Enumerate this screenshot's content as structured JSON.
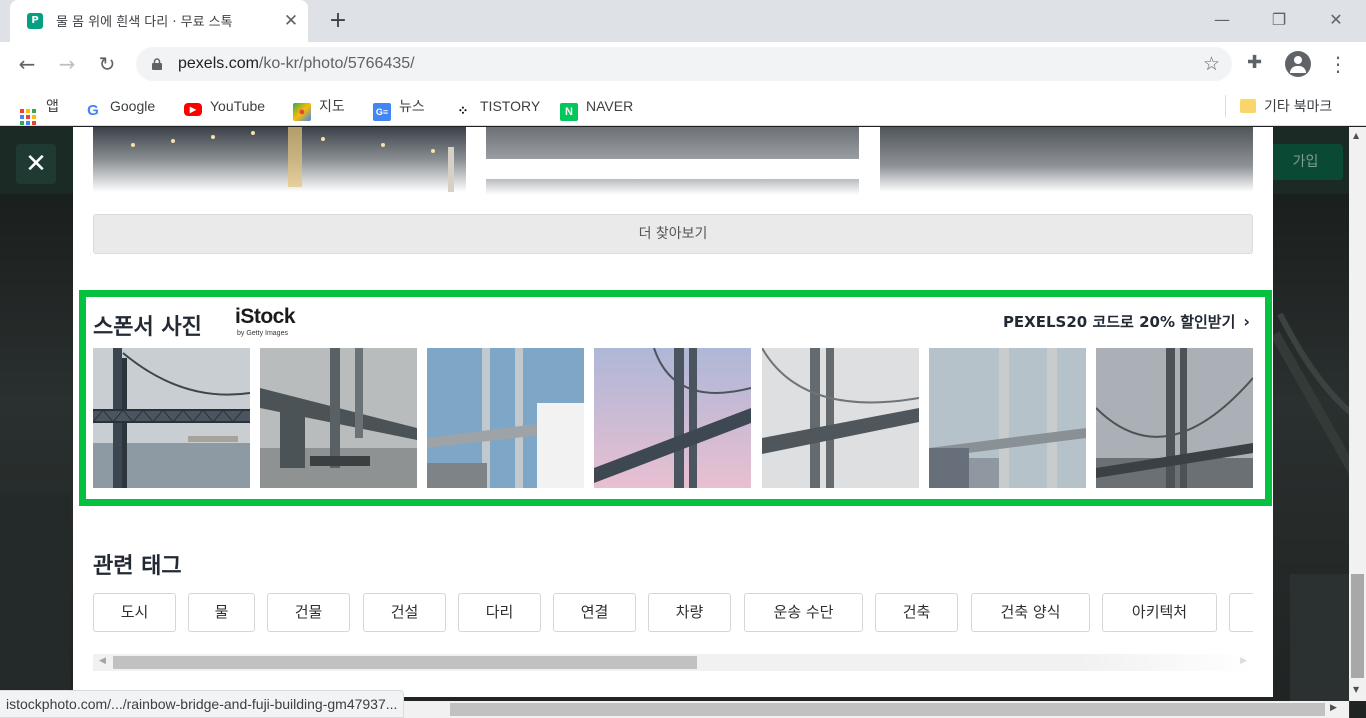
{
  "browser": {
    "tab_title": "물 몸 위에 흰색 다리 · 무료 스톡",
    "tab_favicon": "P",
    "url_host": "pexels.com",
    "url_path": "/ko-kr/photo/5766435/",
    "bookmarks": [
      {
        "label": "앱",
        "icon": "apps-icon"
      },
      {
        "label": "Google",
        "icon": "google-icon"
      },
      {
        "label": "YouTube",
        "icon": "youtube-icon"
      },
      {
        "label": "지도",
        "icon": "maps-icon"
      },
      {
        "label": "뉴스",
        "icon": "news-icon"
      },
      {
        "label": "TISTORY",
        "icon": "tistory-icon"
      },
      {
        "label": "NAVER",
        "icon": "naver-icon"
      }
    ],
    "other_bookmarks": "기타 북마크",
    "status_url": "istockphoto.com/.../rainbow-bridge-and-fuji-building-gm47937..."
  },
  "page": {
    "join_label": "가입",
    "close_symbol": "✕"
  },
  "modal": {
    "more_button": "더 찾아보기",
    "sponsor": {
      "title": "스폰서 사진",
      "logo_word": "iStock",
      "logo_by": "by Getty Images",
      "promo": "PEXELS20 코드로 20% 할인받기",
      "photo_count": 7
    },
    "tags_title": "관련 태그",
    "tags": [
      "도시",
      "물",
      "건물",
      "건설",
      "다리",
      "연결",
      "차량",
      "운송 수단",
      "건축",
      "건축 양식",
      "아키텍처"
    ]
  },
  "colors": {
    "sponsor_border": "#05c13f",
    "pexels_green": "#05a081"
  }
}
